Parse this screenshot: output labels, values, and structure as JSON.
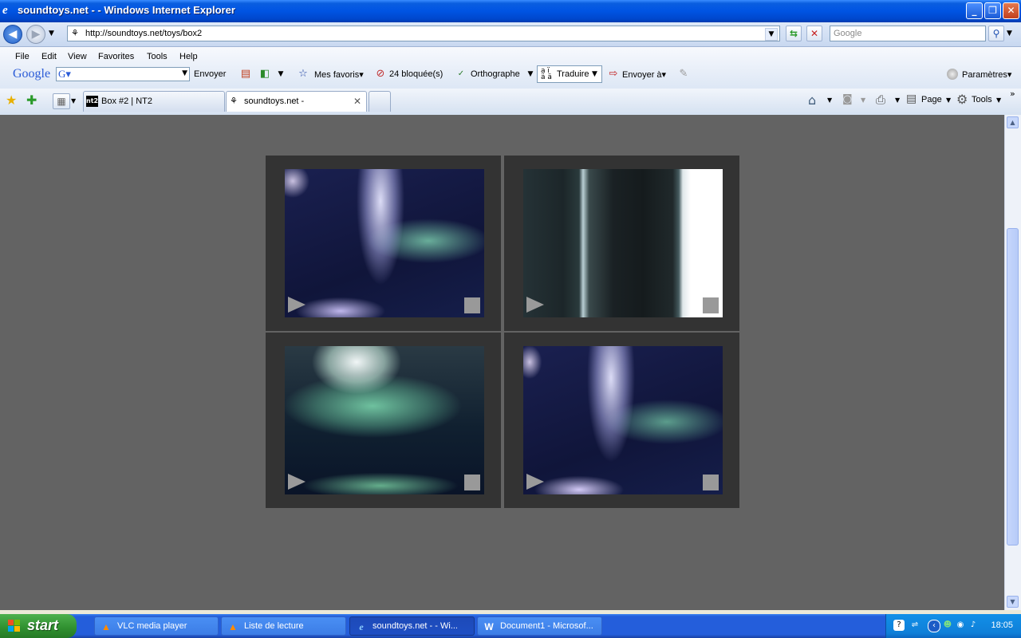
{
  "window": {
    "title": "soundtoys.net - - Windows Internet Explorer"
  },
  "address": {
    "url": "http://soundtoys.net/toys/box2",
    "search_placeholder": "Google"
  },
  "menu": [
    "File",
    "Edit",
    "View",
    "Favorites",
    "Tools",
    "Help"
  ],
  "google_toolbar": {
    "logo": "Google",
    "send": "Envoyer",
    "favorites": "Mes favoris",
    "blocked": "24 bloquée(s)",
    "spelling": "Orthographe",
    "translate": "Traduire",
    "send_to": "Envoyer à",
    "settings": "Paramètres"
  },
  "tabs": [
    {
      "label": "Box #2 | NT2",
      "favicon": "nt2"
    },
    {
      "label": "soundtoys.net -",
      "active": true
    }
  ],
  "command_bar": {
    "page": "Page",
    "tools": "Tools"
  },
  "video_grid": {
    "cells": [
      {
        "name": "video-1"
      },
      {
        "name": "video-2"
      },
      {
        "name": "video-3"
      },
      {
        "name": "video-4"
      }
    ],
    "colors": {
      "background": "#636363",
      "frame": "#333333",
      "controls": "#999999"
    }
  },
  "taskbar": {
    "start": "start",
    "tasks": [
      {
        "label": "VLC media player",
        "icon": "vlc-cone-icon"
      },
      {
        "label": "Liste de lecture",
        "icon": "vlc-cone-icon"
      },
      {
        "label": "soundtoys.net - - Wi...",
        "icon": "ie-icon",
        "active": true
      },
      {
        "label": "Document1 - Microsof...",
        "icon": "word-icon"
      }
    ],
    "clock": "18:05"
  }
}
